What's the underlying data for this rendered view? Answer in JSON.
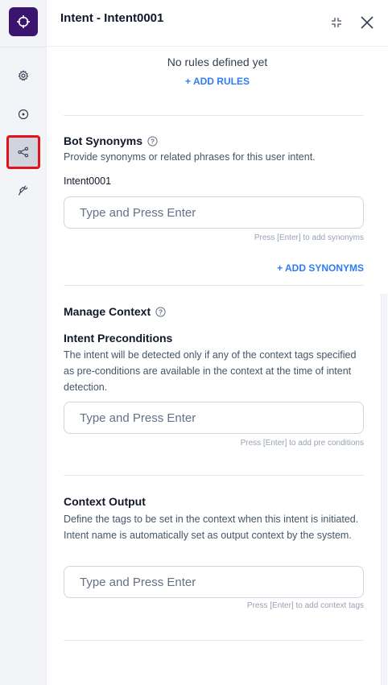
{
  "header": {
    "title": "Intent - Intent0001",
    "collapse_icon": "collapse-icon",
    "close_icon": "close-icon"
  },
  "sidebar": {
    "logo_icon": "crosshair-icon",
    "items": [
      {
        "icon": "gear-icon",
        "active": false
      },
      {
        "icon": "target-icon",
        "active": false
      },
      {
        "icon": "share-icon",
        "active": true
      },
      {
        "icon": "plug-icon",
        "active": false
      }
    ]
  },
  "rules": {
    "empty_text": "No rules defined yet",
    "add_label": "+ ADD RULES"
  },
  "synonyms": {
    "title": "Bot Synonyms",
    "description": "Provide synonyms or related phrases for this user intent.",
    "value": "Intent0001",
    "placeholder": "Type and Press Enter",
    "hint": "Press [Enter] to add synonyms",
    "add_label": "+ ADD SYNONYMS"
  },
  "context": {
    "title": "Manage Context",
    "preconditions": {
      "title": "Intent Preconditions",
      "description": "The intent will be detected only if any of the context tags specified as pre-conditions are available in the context at the time of intent detection.",
      "placeholder": "Type and Press Enter",
      "hint": "Press [Enter] to add pre conditions"
    },
    "output": {
      "title": "Context Output",
      "description": "Define the tags to be set in the context when this intent is initiated. Intent name is automatically set as output context by the system.",
      "placeholder": "Type and Press Enter",
      "hint": "Press [Enter] to add context tags"
    }
  },
  "colors": {
    "accent": "#2e7cf6",
    "brand": "#3b1470",
    "highlight": "#e0121b"
  }
}
